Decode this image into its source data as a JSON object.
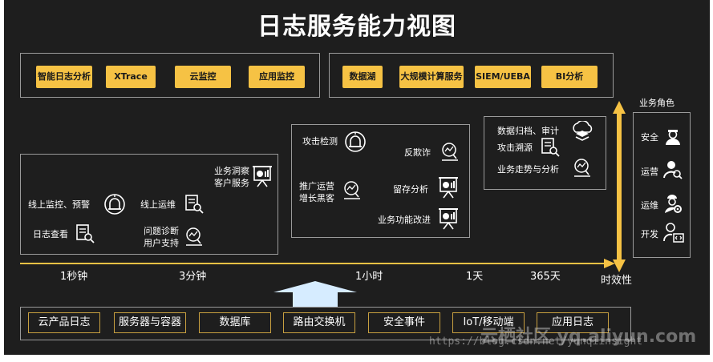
{
  "title": "日志服务能力视图",
  "top_left_buttons": [
    "智能日志分析",
    "XTrace",
    "云监控",
    "应用监控"
  ],
  "top_right_buttons": [
    "数据湖",
    "大规模计算服务",
    "SIEM/UEBA",
    "BI分析"
  ],
  "panel_1": {
    "items": [
      "线上监控、预警",
      "日志查看",
      "线上运维",
      "问题诊断",
      "用户支持",
      "业务洞察",
      "客户服务"
    ]
  },
  "panel_2": {
    "items": [
      "攻击检测",
      "反欺诈",
      "推广运营",
      "增长黑客",
      "留存分析",
      "业务功能改进"
    ]
  },
  "panel_3": {
    "items": [
      "数据归档、审计",
      "攻击溯源",
      "业务走势与分析"
    ]
  },
  "roles": {
    "title": "业务角色",
    "items": [
      "安全",
      "运营",
      "运维",
      "开发"
    ]
  },
  "timeline": {
    "ticks": [
      "1秒钟",
      "3分钟",
      "1小时",
      "1天",
      "365天"
    ],
    "axis_label": "时效性"
  },
  "sources": [
    "云产品日志",
    "服务器与容器",
    "数据库",
    "路由交换机",
    "安全事件",
    "IoT/移动端",
    "应用日志"
  ],
  "watermark": "https://blog.csdn.net/yunqiinsight",
  "watermark_logo": "云栖社区 yq.aliyun.com",
  "colors": {
    "accent": "#f6c244",
    "background": "#1e1e1e",
    "arrow": "#d6ecff"
  }
}
